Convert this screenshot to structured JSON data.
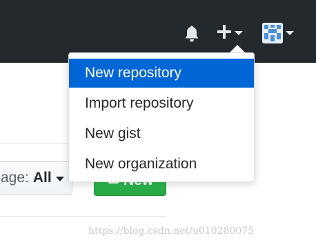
{
  "header": {
    "notifications_icon": "bell-icon",
    "create_icon": "plus-icon",
    "avatar_icon": "identicon-avatar"
  },
  "create_menu": {
    "items": [
      {
        "label": "New repository",
        "active": true
      },
      {
        "label": "Import repository",
        "active": false
      },
      {
        "label": "New gist",
        "active": false
      },
      {
        "label": "New organization",
        "active": false
      }
    ]
  },
  "toolbar": {
    "filter_prefix": "age:",
    "filter_value": "All",
    "new_label": "New"
  },
  "watermark": "https://blog.csdn.net/u010280075",
  "colors": {
    "header_bg": "#24292e",
    "menu_active_bg": "#0366d6",
    "new_button_bg": "#28a745"
  }
}
